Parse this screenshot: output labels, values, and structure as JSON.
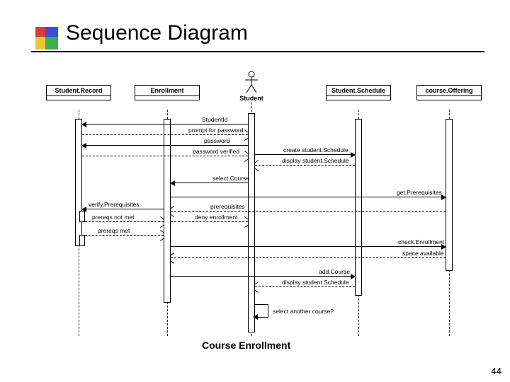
{
  "title": "Sequence Diagram",
  "caption": "Course Enrollment",
  "page_number": "44",
  "participants": {
    "p1": "Student.Record",
    "p2": "Enrollment",
    "p4": "Student.Schedule",
    "p5": "course.Offering"
  },
  "actor": "Student",
  "messages": {
    "m1": "StudentId",
    "m2": "prompt for password",
    "m3": "password",
    "m4": "password verified",
    "m5": "create student.Schedule",
    "m6": "display student.Schedule",
    "m7": "select.Course",
    "m8": "get.Prerequisites",
    "m9": "verify.Prerequisites",
    "m10": "prerequisites",
    "m11": "prereqs not met",
    "m12": "deny enrollment",
    "m13": "prereqs met",
    "m14": "check.Enrollment",
    "m15": "space available",
    "m16": "add.Course",
    "m17": "display student.Schedule",
    "m18": "select another course?"
  },
  "chart_data": {
    "type": "sequence",
    "title": "Course Enrollment",
    "participants": [
      {
        "id": "StudentRecord",
        "label": "Student.Record",
        "kind": "object"
      },
      {
        "id": "Enrollment",
        "label": "Enrollment",
        "kind": "object"
      },
      {
        "id": "Student",
        "label": "Student",
        "kind": "actor"
      },
      {
        "id": "StudentSchedule",
        "label": "Student.Schedule",
        "kind": "object"
      },
      {
        "id": "CourseOffering",
        "label": "course.Offering",
        "kind": "object"
      }
    ],
    "messages": [
      {
        "from": "Student",
        "to": "StudentRecord",
        "label": "StudentId",
        "type": "sync"
      },
      {
        "from": "StudentRecord",
        "to": "Student",
        "label": "prompt for password",
        "type": "return"
      },
      {
        "from": "Student",
        "to": "StudentRecord",
        "label": "password",
        "type": "sync"
      },
      {
        "from": "StudentRecord",
        "to": "Student",
        "label": "password verified",
        "type": "return"
      },
      {
        "from": "Student",
        "to": "StudentSchedule",
        "label": "create student.Schedule",
        "type": "sync"
      },
      {
        "from": "StudentSchedule",
        "to": "Student",
        "label": "display student.Schedule",
        "type": "return"
      },
      {
        "from": "Student",
        "to": "Enrollment",
        "label": "select.Course",
        "type": "sync"
      },
      {
        "from": "Enrollment",
        "to": "CourseOffering",
        "label": "get.Prerequisites",
        "type": "sync"
      },
      {
        "from": "Enrollment",
        "to": "StudentRecord",
        "label": "verify.Prerequisites",
        "type": "sync"
      },
      {
        "from": "CourseOffering",
        "to": "Enrollment",
        "label": "prerequisites",
        "type": "return"
      },
      {
        "from": "StudentRecord",
        "to": "Enrollment",
        "label": "prereqs not met",
        "type": "return"
      },
      {
        "from": "Enrollment",
        "to": "Student",
        "label": "deny enrollment",
        "type": "return"
      },
      {
        "from": "StudentRecord",
        "to": "Enrollment",
        "label": "prereqs met",
        "type": "return"
      },
      {
        "from": "Enrollment",
        "to": "CourseOffering",
        "label": "check.Enrollment",
        "type": "sync"
      },
      {
        "from": "CourseOffering",
        "to": "Enrollment",
        "label": "space available",
        "type": "return"
      },
      {
        "from": "Enrollment",
        "to": "StudentSchedule",
        "label": "add.Course",
        "type": "sync"
      },
      {
        "from": "StudentSchedule",
        "to": "Student",
        "label": "display student.Schedule",
        "type": "return"
      },
      {
        "from": "Student",
        "to": "Student",
        "label": "select another course?",
        "type": "self"
      }
    ]
  }
}
